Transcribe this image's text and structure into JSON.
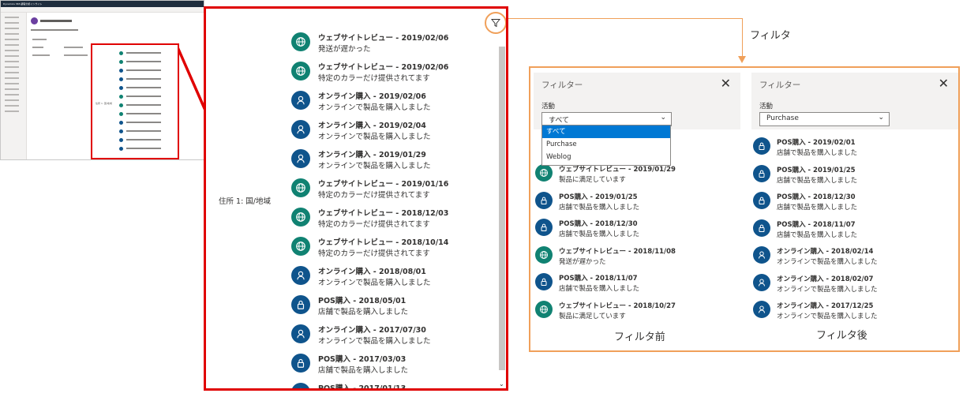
{
  "mini": {
    "app_title": "Dynamics 365  顧客分析インサイト",
    "side_label": "住所 1: 国/地域"
  },
  "zoom": {
    "side_label": "住所 1: 国/地域",
    "items": [
      {
        "title": "ウェブサイトレビュー - 2019/02/06",
        "subtitle": "発送が遅かった",
        "icon": "globe-icon",
        "color": "#108272"
      },
      {
        "title": "ウェブサイトレビュー - 2019/02/06",
        "subtitle": "特定のカラーだけ提供されてます",
        "icon": "globe-icon",
        "color": "#108272"
      },
      {
        "title": "オンライン購入 - 2019/02/06",
        "subtitle": "オンラインで製品を購入しました",
        "icon": "person-icon",
        "color": "#0f548c"
      },
      {
        "title": "オンライン購入 - 2019/02/04",
        "subtitle": "オンラインで製品を購入しました",
        "icon": "person-icon",
        "color": "#0f548c"
      },
      {
        "title": "オンライン購入 - 2019/01/29",
        "subtitle": "オンラインで製品を購入しました",
        "icon": "person-icon",
        "color": "#0f548c"
      },
      {
        "title": "ウェブサイトレビュー - 2019/01/16",
        "subtitle": "特定のカラーだけ提供されてます",
        "icon": "globe-icon",
        "color": "#108272"
      },
      {
        "title": "ウェブサイトレビュー - 2018/12/03",
        "subtitle": "特定のカラーだけ提供されてます",
        "icon": "globe-icon",
        "color": "#108272"
      },
      {
        "title": "ウェブサイトレビュー - 2018/10/14",
        "subtitle": "特定のカラーだけ提供されてます",
        "icon": "globe-icon",
        "color": "#108272"
      },
      {
        "title": "オンライン購入 - 2018/08/01",
        "subtitle": "オンラインで製品を購入しました",
        "icon": "person-icon",
        "color": "#0f548c"
      },
      {
        "title": "POS購入 - 2018/05/01",
        "subtitle": "店舗で製品を購入しました",
        "icon": "lock-icon",
        "color": "#0f548c"
      },
      {
        "title": "オンライン購入 - 2017/07/30",
        "subtitle": "オンラインで製品を購入しました",
        "icon": "person-icon",
        "color": "#0f548c"
      },
      {
        "title": "POS購入 - 2017/03/03",
        "subtitle": "店舗で製品を購入しました",
        "icon": "lock-icon",
        "color": "#0f548c"
      },
      {
        "title": "POS購入 - 2017/01/13",
        "subtitle": "",
        "icon": "lock-icon",
        "color": "#0f548c"
      }
    ]
  },
  "annotation": {
    "label": "フィルタ"
  },
  "before": {
    "panel_title": "フィルター",
    "close_glyph": "✕",
    "field_label": "活動",
    "selected": "すべて",
    "options": [
      "すべて",
      "Purchase",
      "Weblog"
    ],
    "items": [
      {
        "title": "ウェブサイトレビュー - 2019/01/29",
        "subtitle": "製品に満足しています",
        "icon": "globe-icon",
        "color": "#108272"
      },
      {
        "title": "POS購入 - 2019/01/25",
        "subtitle": "店舗で製品を購入しました",
        "icon": "lock-icon",
        "color": "#0f548c"
      },
      {
        "title": "POS購入 - 2018/12/30",
        "subtitle": "店舗で製品を購入しました",
        "icon": "lock-icon",
        "color": "#0f548c"
      },
      {
        "title": "ウェブサイトレビュー - 2018/11/08",
        "subtitle": "発送が遅かった",
        "icon": "globe-icon",
        "color": "#108272"
      },
      {
        "title": "POS購入 - 2018/11/07",
        "subtitle": "店舗で製品を購入しました",
        "icon": "lock-icon",
        "color": "#0f548c"
      },
      {
        "title": "ウェブサイトレビュー - 2018/10/27",
        "subtitle": "製品に満足しています",
        "icon": "globe-icon",
        "color": "#108272"
      }
    ],
    "caption": "フィルタ前"
  },
  "after": {
    "panel_title": "フィルター",
    "close_glyph": "✕",
    "field_label": "活動",
    "selected": "Purchase",
    "items": [
      {
        "title": "POS購入 - 2019/02/01",
        "subtitle": "店舗で製品を購入しました",
        "icon": "lock-icon",
        "color": "#0f548c"
      },
      {
        "title": "POS購入 - 2019/01/25",
        "subtitle": "店舗で製品を購入しました",
        "icon": "lock-icon",
        "color": "#0f548c"
      },
      {
        "title": "POS購入 - 2018/12/30",
        "subtitle": "店舗で製品を購入しました",
        "icon": "lock-icon",
        "color": "#0f548c"
      },
      {
        "title": "POS購入 - 2018/11/07",
        "subtitle": "店舗で製品を購入しました",
        "icon": "lock-icon",
        "color": "#0f548c"
      },
      {
        "title": "オンライン購入 - 2018/02/14",
        "subtitle": "オンラインで製品を購入しました",
        "icon": "person-icon",
        "color": "#0f548c"
      },
      {
        "title": "オンライン購入 - 2018/02/07",
        "subtitle": "オンラインで製品を購入しました",
        "icon": "person-icon",
        "color": "#0f548c"
      },
      {
        "title": "オンライン購入 - 2017/12/25",
        "subtitle": "オンラインで製品を購入しました",
        "icon": "person-icon",
        "color": "#0f548c"
      }
    ],
    "caption": "フィルタ後"
  },
  "colors": {
    "red_frame": "#e00000",
    "orange_annotation": "#f0a05a",
    "selected_option": "#0078d4"
  }
}
